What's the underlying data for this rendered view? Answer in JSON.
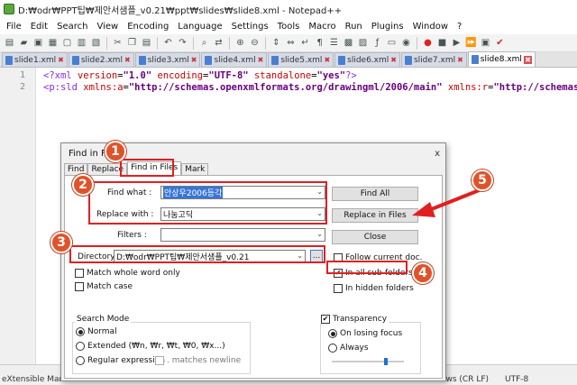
{
  "window": {
    "title": "D:₩odr₩PPT팁₩제안서샘플_v0.21₩ppt₩slides₩slide8.xml - Notepad++"
  },
  "menu": [
    "File",
    "Edit",
    "Search",
    "View",
    "Encoding",
    "Language",
    "Settings",
    "Tools",
    "Macro",
    "Run",
    "Plugins",
    "Window",
    "?"
  ],
  "tabs": [
    {
      "label": "slide1.xml",
      "active": false
    },
    {
      "label": "slide2.xml",
      "active": false
    },
    {
      "label": "slide3.xml",
      "active": false
    },
    {
      "label": "slide4.xml",
      "active": false
    },
    {
      "label": "slide5.xml",
      "active": false
    },
    {
      "label": "slide6.xml",
      "active": false
    },
    {
      "label": "slide7.xml",
      "active": false
    },
    {
      "label": "slide8.xml",
      "active": true
    }
  ],
  "editor": {
    "line_numbers": [
      "1",
      "2"
    ],
    "line1": {
      "open": "<?xml ",
      "a1": "version",
      "eq1": "=",
      "v1": "\"1.0\"",
      "a2": " encoding",
      "eq2": "=",
      "v2": "\"UTF-8\"",
      "a3": " standalone",
      "eq3": "=",
      "v3": "\"yes\"",
      "close": "?>"
    },
    "line2": {
      "open": "<p:sld ",
      "a1": "xmlns:a",
      "eq1": "=",
      "v1": "\"http://schemas.openxmlformats.org/drawingml/2006/main\"",
      "a2": " xmlns:r",
      "eq2": "=",
      "v2": "\"http://schemas"
    }
  },
  "dialog": {
    "title": "Find in Files",
    "close": "x",
    "tabs": [
      "Find",
      "Replace",
      "Find in Files",
      "Mark"
    ],
    "find_what_label": "Find what :",
    "find_what_value": "안상우2006등각",
    "replace_with_label": "Replace with :",
    "replace_with_value": "나눔고딕",
    "filters_label": "Filters :",
    "filters_value": "",
    "directory_label": "Directory :",
    "directory_value": "D:₩odr₩PPT팁₩제안서샘플_v0.21",
    "browse": "...",
    "buttons": {
      "find_all": "Find All",
      "replace_in_files": "Replace in Files",
      "close": "Close"
    },
    "checks": {
      "match_whole_word": "Match whole word only",
      "match_case": "Match case",
      "follow_current": "Follow current doc.",
      "in_all_sub": "In all sub-folders",
      "in_hidden": "In hidden folders"
    },
    "search_mode": {
      "title": "Search Mode",
      "normal": "Normal",
      "extended": "Extended (₩n, ₩r, ₩t, ₩0, ₩x...)",
      "regex": "Regular expression",
      "matches_newline": ". matches newline"
    },
    "transparency": {
      "title": "Transparency",
      "on_losing": "On losing focus",
      "always": "Always",
      "slider_level": 0.75
    }
  },
  "status": {
    "left": "eXtensible Mar",
    "eol": "ows (CR LF)",
    "encoding": "UTF-8"
  },
  "annotations": {
    "n1": "1",
    "n2": "2",
    "n3": "3",
    "n4": "4",
    "n5": "5"
  },
  "colors": {
    "annotation_red": "#e02020",
    "marker_orange": "#e0532a",
    "selection_blue": "#3875d7"
  }
}
